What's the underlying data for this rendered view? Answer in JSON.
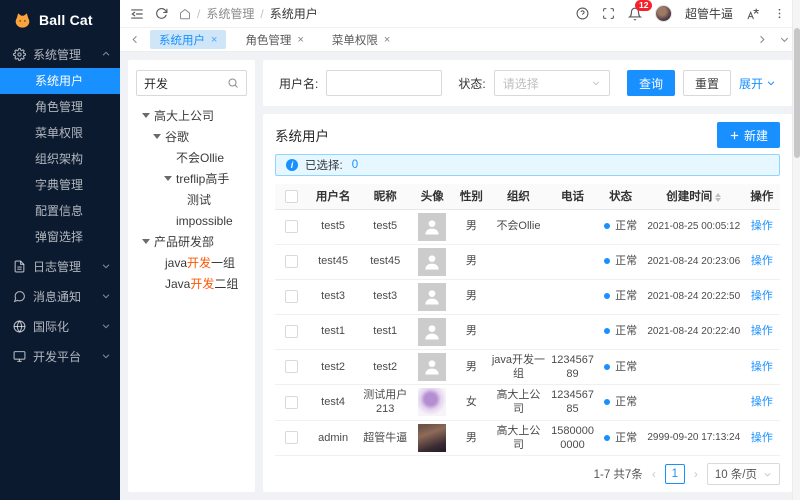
{
  "brand": {
    "name": "Ball Cat"
  },
  "sidebar": {
    "menu": [
      {
        "icon": "gear-icon",
        "label": "系统管理",
        "state": "expanded",
        "children": [
          {
            "label": "系统用户",
            "active": true
          },
          {
            "label": "角色管理",
            "active": false
          },
          {
            "label": "菜单权限",
            "active": false
          },
          {
            "label": "组织架构",
            "active": false
          },
          {
            "label": "字典管理",
            "active": false
          },
          {
            "label": "配置信息",
            "active": false
          },
          {
            "label": "弹窗选择",
            "active": false
          }
        ]
      },
      {
        "icon": "log-icon",
        "label": "日志管理",
        "state": "collapsed",
        "children": []
      },
      {
        "icon": "message-icon",
        "label": "消息通知",
        "state": "collapsed",
        "children": []
      },
      {
        "icon": "globe-icon",
        "label": "国际化",
        "state": "collapsed",
        "children": []
      },
      {
        "icon": "monitor-icon",
        "label": "开发平台",
        "state": "collapsed",
        "children": []
      }
    ]
  },
  "topbar": {
    "breadcrumb": {
      "separator": "/",
      "items": [
        "系统管理",
        "系统用户"
      ]
    },
    "badge_count": "12",
    "username": "超管牛逼"
  },
  "tabbar": {
    "tabs": [
      {
        "label": "系统用户",
        "active": true
      },
      {
        "label": "角色管理",
        "active": false
      },
      {
        "label": "菜单权限",
        "active": false
      }
    ],
    "close_glyph": "×"
  },
  "org_tree": {
    "search_value": "开发",
    "nodes": [
      {
        "level": 0,
        "expandable": true,
        "parts": [
          {
            "text": "高大上公司"
          }
        ]
      },
      {
        "level": 1,
        "expandable": true,
        "parts": [
          {
            "text": "谷歌"
          }
        ]
      },
      {
        "level": 2,
        "expandable": false,
        "parts": [
          {
            "text": "不会Ollie"
          }
        ]
      },
      {
        "level": 2,
        "expandable": true,
        "parts": [
          {
            "text": "treflip高手"
          }
        ]
      },
      {
        "level": 3,
        "expandable": false,
        "parts": [
          {
            "text": "测试"
          }
        ]
      },
      {
        "level": 2,
        "expandable": false,
        "parts": [
          {
            "text": "impossible"
          }
        ]
      },
      {
        "level": 0,
        "expandable": true,
        "parts": [
          {
            "text": "产品研发部"
          }
        ]
      },
      {
        "level": 1,
        "expandable": false,
        "parts": [
          {
            "text": "java "
          },
          {
            "text": "开发",
            "highlight": true
          },
          {
            "text": " 一组"
          }
        ]
      },
      {
        "level": 1,
        "expandable": false,
        "parts": [
          {
            "text": "Java "
          },
          {
            "text": "开发",
            "highlight": true
          },
          {
            "text": " 二组"
          }
        ]
      }
    ]
  },
  "query_form": {
    "username_label": "用户名:",
    "username_value": "",
    "status_label": "状态:",
    "status_placeholder": "请选择",
    "search_button": "查询",
    "reset_button": "重置",
    "expand_button": "展开"
  },
  "user_table": {
    "title": "系统用户",
    "create_button": "新建",
    "selection_hint": {
      "label": "已选择:",
      "count": "0"
    },
    "columns": [
      {
        "label": "用户名"
      },
      {
        "label": "昵称"
      },
      {
        "label": "头像"
      },
      {
        "label": "性别"
      },
      {
        "label": "组织"
      },
      {
        "label": "电话"
      },
      {
        "label": "状态"
      },
      {
        "label": "创建时间",
        "sortable": true
      },
      {
        "label": "操作"
      }
    ],
    "action_label": "操作",
    "rows": [
      {
        "username": "test5",
        "nickname": "test5",
        "avatar": "placeholder",
        "gender": "男",
        "org": "不会Ollie",
        "phone": "",
        "status": "正常",
        "created_at": "2021-08-25 00:05:12"
      },
      {
        "username": "test45",
        "nickname": "test45",
        "avatar": "placeholder",
        "gender": "男",
        "org": "",
        "phone": "",
        "status": "正常",
        "created_at": "2021-08-24 20:23:06"
      },
      {
        "username": "test3",
        "nickname": "test3",
        "avatar": "placeholder",
        "gender": "男",
        "org": "",
        "phone": "",
        "status": "正常",
        "created_at": "2021-08-24 20:22:50"
      },
      {
        "username": "test1",
        "nickname": "test1",
        "avatar": "placeholder",
        "gender": "男",
        "org": "",
        "phone": "",
        "status": "正常",
        "created_at": "2021-08-24 20:22:40"
      },
      {
        "username": "test2",
        "nickname": "test2",
        "avatar": "placeholder",
        "gender": "男",
        "org": "java开发一组",
        "phone": "123456789",
        "status": "正常",
        "created_at": ""
      },
      {
        "username": "test4",
        "nickname": "测试用户213",
        "avatar": "flower",
        "gender": "女",
        "org": "高大上公司",
        "phone": "123456785",
        "status": "正常",
        "created_at": ""
      },
      {
        "username": "admin",
        "nickname": "超管牛逼",
        "avatar": "portrait",
        "gender": "男",
        "org": "高大上公司",
        "phone": "15800000000",
        "status": "正常",
        "created_at": "2999-09-20 17:13:24"
      }
    ],
    "pagination": {
      "total": "1-7 共7条",
      "current_page": "1",
      "page_size": "10 条/页"
    }
  },
  "colors": {
    "accent": "#1890ff",
    "sidebar_bg": "#0c1a30",
    "badge_red": "#f5222d",
    "tree_highlight": "#ff5500",
    "alert_bg": "#e6f7ff",
    "alert_border": "#91d5ff",
    "tab_active_bg": "#cfe5f8",
    "status_dot": "#1890ff"
  }
}
